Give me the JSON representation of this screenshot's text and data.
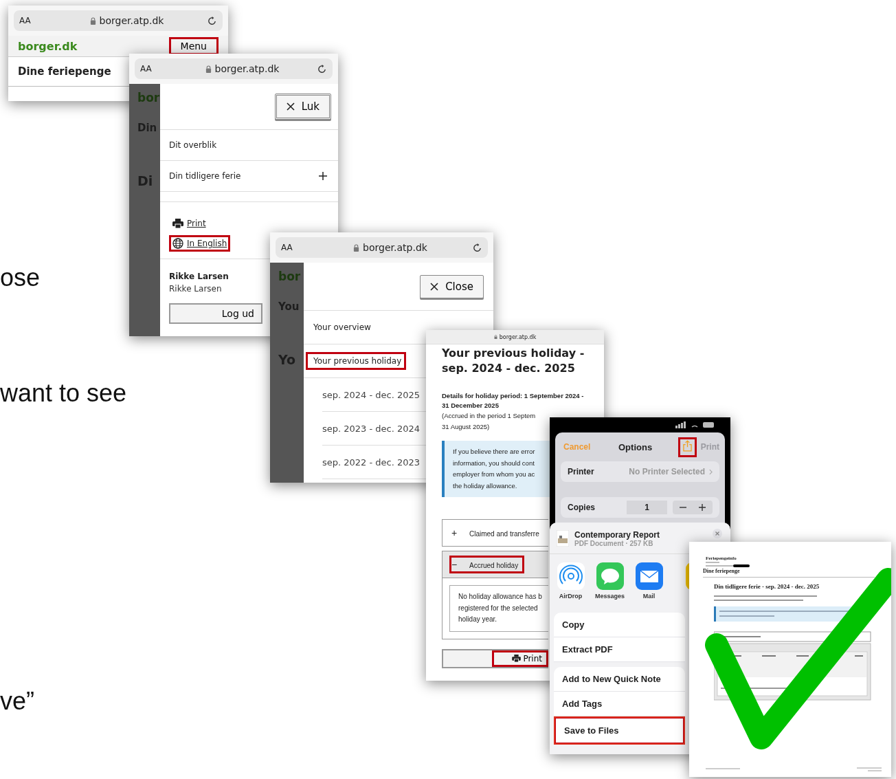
{
  "slide_text": [
    {
      "text": "ose"
    },
    {
      "text": "want to see"
    },
    {
      "text": "ve”"
    }
  ],
  "screen_1": {
    "browser": {
      "text_size": "AA",
      "url": "borger.atp.dk"
    },
    "logo": "borger.dk",
    "menu_button": {
      "label": "Menu",
      "highlighted": true
    },
    "title": "Dine feriepenge"
  },
  "screen_2": {
    "browser": {
      "text_size": "AA",
      "url": "borger.atp.dk"
    },
    "background_fragments": [
      "bor",
      "Din",
      "Di"
    ],
    "close_button": {
      "label": "Luk"
    },
    "menu_items": [
      {
        "label": "Dit overblik",
        "expandable": false
      },
      {
        "label": "Din tidligere ferie",
        "expandable": true
      }
    ],
    "links": [
      {
        "kind": "print",
        "label": "Print",
        "highlighted": false
      },
      {
        "kind": "language",
        "label": "In English",
        "highlighted": true
      }
    ],
    "user_name": "Rikke Larsen",
    "user_subtitle": "Rikke Larsen",
    "logout_button": "Log ud"
  },
  "screen_3": {
    "browser": {
      "text_size": "AA",
      "url": "borger.atp.dk"
    },
    "background_fragments": [
      "bor",
      "You",
      "Yo"
    ],
    "close_button": {
      "label": "Close"
    },
    "menu_items": [
      {
        "label": "Your overview",
        "highlighted": false
      },
      {
        "label": "Your previous holiday",
        "highlighted": true
      }
    ],
    "sub_items": [
      "sep. 2024 - dec. 2025",
      "sep. 2023 - dec. 2024",
      "sep. 2022 - dec. 2023"
    ]
  },
  "screen_4": {
    "url": "borger.atp.dk",
    "title": "Your previous holiday - sep. 2024 - dec. 2025",
    "details": "Details for holiday period: 1 September 2024 - 31 December 2025",
    "accrued_lines": [
      "(Accrued in the period 1 Septem",
      "31 August 2025)"
    ],
    "notice_lines": [
      "If you believe there are error",
      "information, you should cont",
      "employer from whom you ac",
      "the holiday allowance."
    ],
    "accordions": [
      {
        "sign": "+",
        "label": "Claimed and transferre",
        "expanded": false,
        "highlighted": false
      },
      {
        "sign": "−",
        "label": "Accrued holiday",
        "expanded": true,
        "highlighted": true
      }
    ],
    "empty_lines": [
      "No holiday allowance has b",
      "registered for the selected",
      "holiday year."
    ],
    "print_button": {
      "label": "Print",
      "highlighted": true
    }
  },
  "screen_5": {
    "cancel": "Cancel",
    "title": "Options",
    "share_highlighted": true,
    "print": {
      "label": "Print",
      "disabled": true
    },
    "printer": {
      "label": "Printer",
      "value": "No Printer Selected"
    },
    "copies": {
      "label": "Copies",
      "value": "1"
    },
    "file": {
      "name": "Contemporary Report",
      "info": "PDF Document · 257 KB"
    },
    "apps": [
      {
        "kind": "airdrop",
        "label": "AirDrop"
      },
      {
        "kind": "messages",
        "label": "Messages"
      },
      {
        "kind": "mail",
        "label": "Mail"
      },
      {
        "kind": "notes"
      }
    ],
    "actions": [
      {
        "label": "Copy",
        "new_group": true,
        "highlighted": false
      },
      {
        "label": "Extract PDF",
        "new_group": false,
        "highlighted": false
      },
      {
        "label": "Add to New Quick Note",
        "new_group": true,
        "highlighted": false
      },
      {
        "label": "Add Tags",
        "new_group": false,
        "highlighted": false
      },
      {
        "label": "Save to Files",
        "new_group": false,
        "highlighted": true
      }
    ]
  },
  "screen_6": {
    "header_lines": [
      "Feriepengeinfo"
    ],
    "page_title": "Dine feriepenge",
    "heading": "Din tidligere ferie - sep. 2024 - dec. 2025"
  }
}
